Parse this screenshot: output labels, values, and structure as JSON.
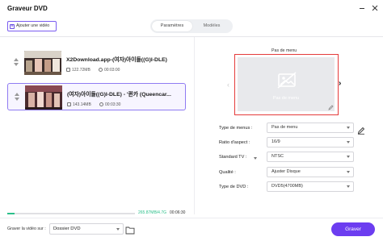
{
  "window": {
    "title": "Graveur DVD",
    "minimize_icon": "minimize-icon",
    "close_icon": "close-icon"
  },
  "toolbar": {
    "add_video_label": "Ajouter une vidéo"
  },
  "tabs": [
    {
      "label": "Paramètres",
      "active": true
    },
    {
      "label": "Modèles",
      "active": false
    }
  ],
  "videos": [
    {
      "name": "X2Download.app-(여자)아이들((G)I-DLE)",
      "size": "122.72MB",
      "duration": "00:03:00",
      "selected": false
    },
    {
      "name": "(여자)아이들((G)I-DLE) - '퀸카 (Queencar...",
      "size": "143.14MB",
      "duration": "00:03:30",
      "selected": true
    }
  ],
  "menu_preview": {
    "label": "Pas de menu",
    "placeholder_text": "Pas de menu",
    "image_icon": "image-off-icon",
    "edit_icon": "pencil-icon"
  },
  "settings": {
    "menu_type": {
      "label": "Type de menus :",
      "value": "Pas de menu"
    },
    "aspect_ratio": {
      "label": "Ratio d'aspect :",
      "value": "16/9"
    },
    "tv_standard": {
      "label": "Standard TV :",
      "value": "NTSC"
    },
    "quality": {
      "label": "Qualité :",
      "value": "Ajuster Disque"
    },
    "dvd_type": {
      "label": "Type de DVD :",
      "value": "DVD5(4700MB)"
    }
  },
  "capacity": {
    "used_text": "265.87MB/4.7G",
    "total_duration": "00:06:30",
    "fill_fraction": 0.06
  },
  "footer": {
    "save_label": "Graver la vidéo sur :",
    "destination": "Dossier DVD",
    "burn_label": "Graver"
  },
  "colors": {
    "accent": "#6c3df0",
    "selection": "#8f7bf2",
    "highlight_border": "#e53b3b",
    "progress": "#2bbf8a"
  }
}
